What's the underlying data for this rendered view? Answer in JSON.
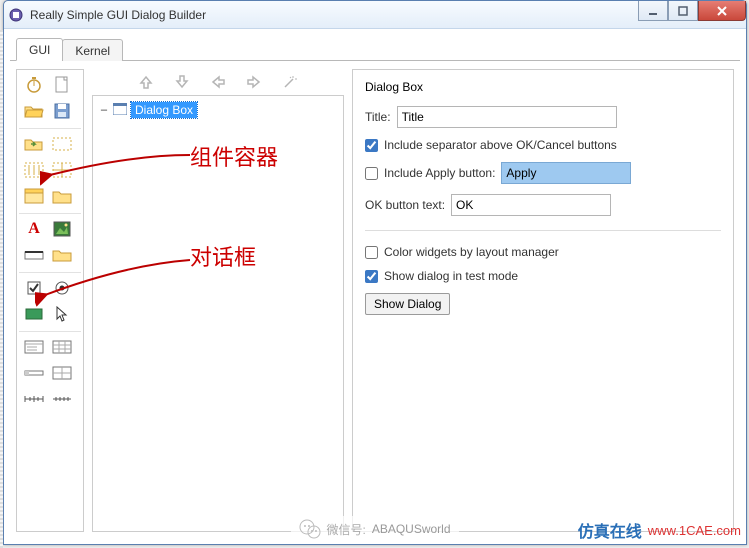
{
  "window": {
    "title": "Really Simple GUI Dialog Builder"
  },
  "tabs": [
    {
      "label": "GUI",
      "active": true
    },
    {
      "label": "Kernel",
      "active": false
    }
  ],
  "tree": {
    "root": {
      "label": "Dialog Box",
      "selected": true
    }
  },
  "props": {
    "heading": "Dialog Box",
    "title_label": "Title:",
    "title_value": "Title",
    "include_separator": {
      "checked": true,
      "label": "Include separator above OK/Cancel buttons"
    },
    "include_apply": {
      "checked": false,
      "label": "Include Apply button:",
      "value": "Apply"
    },
    "ok_label": "OK button text:",
    "ok_value": "OK",
    "color_by_layout": {
      "checked": false,
      "label": "Color widgets by layout manager"
    },
    "show_test": {
      "checked": true,
      "label": "Show dialog in test mode"
    },
    "show_button": "Show Dialog"
  },
  "annotations": {
    "container": "组件容器",
    "dialog": "对话框"
  },
  "watermark": {
    "weixin_label": "微信号:",
    "weixin_name": "ABAQUSworld"
  },
  "sitebadge": {
    "zh": "仿真在线",
    "url": "www.1CAE.com"
  },
  "palette_icons": [
    [
      "timer-icon",
      "page-icon"
    ],
    [
      "folder-open-icon",
      "save-icon"
    ],
    [
      "folder-arrow-icon",
      "dashed-box-icon"
    ],
    [
      "vlines-box-icon",
      "grid-box-icon"
    ],
    [
      "panel-icon",
      "folder-icon"
    ],
    [
      "text-a-icon",
      "picture-icon"
    ],
    [
      "tray-icon",
      "folder2-icon"
    ],
    [
      "checkbox-icon",
      "radio-icon"
    ],
    [
      "rect-icon",
      "cursor-icon"
    ],
    [
      "list-icon",
      "table-icon"
    ],
    [
      "hbar-icon",
      "grid2-icon"
    ],
    [
      "scale-icon",
      "scale2-icon"
    ],
    [
      "blank-icon",
      "blank-icon"
    ]
  ]
}
